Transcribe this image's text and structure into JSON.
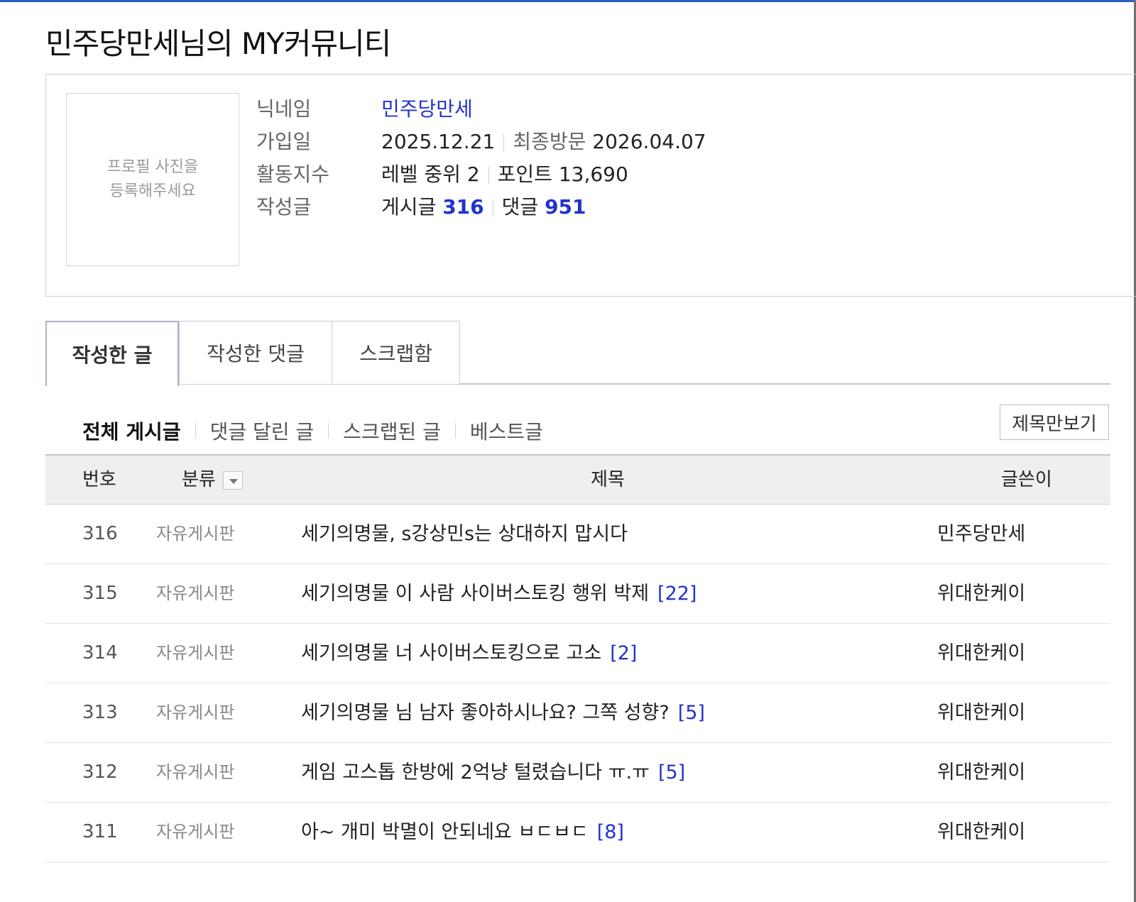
{
  "page_title": "민주당만세님의 MY커뮤니티",
  "profile": {
    "photo_placeholder_line1": "프로필 사진을",
    "photo_placeholder_line2": "등록해주세요",
    "labels": {
      "nickname": "닉네임",
      "joined": "가입일",
      "activity": "활동지수",
      "posts": "작성글"
    },
    "nickname": "민주당만세",
    "joined_date": "2025.12.21",
    "last_visit_label": "최종방문",
    "last_visit_date": "2026.04.07",
    "level_text": "레벨 중위 2",
    "points_text": "포인트 13,690",
    "post_label": "게시글",
    "post_count": "316",
    "comment_label": "댓글",
    "comment_count": "951"
  },
  "tabs": [
    "작성한 글",
    "작성한 댓글",
    "스크랩함"
  ],
  "filters": [
    "전체 게시글",
    "댓글 달린 글",
    "스크랩된 글",
    "베스트글"
  ],
  "title_only_button": "제목만보기",
  "table": {
    "headers": {
      "number": "번호",
      "category": "분류",
      "title": "제목",
      "author": "글쓴이"
    },
    "rows": [
      {
        "number": "316",
        "category": "자유게시판",
        "title": "세기의명물, s강상민s는 상대하지 맙시다",
        "comments": "",
        "author": "민주당만세"
      },
      {
        "number": "315",
        "category": "자유게시판",
        "title": "세기의명물 이 사람 사이버스토킹 행위 박제",
        "comments": "[22]",
        "author": "위대한케이"
      },
      {
        "number": "314",
        "category": "자유게시판",
        "title": "세기의명물 너 사이버스토킹으로 고소",
        "comments": "[2]",
        "author": "위대한케이"
      },
      {
        "number": "313",
        "category": "자유게시판",
        "title": "세기의명물 님 남자 좋아하시나요? 그쪽 성향?",
        "comments": "[5]",
        "author": "위대한케이"
      },
      {
        "number": "312",
        "category": "자유게시판",
        "title": "게임 고스톱 한방에 2억냥 털렸습니다 ㅠ.ㅠ",
        "comments": "[5]",
        "author": "위대한케이"
      },
      {
        "number": "311",
        "category": "자유게시판",
        "title": "아~ 개미 박멸이 안되네요 ㅂㄷㅂㄷ",
        "comments": "[8]",
        "author": "위대한케이"
      }
    ]
  }
}
